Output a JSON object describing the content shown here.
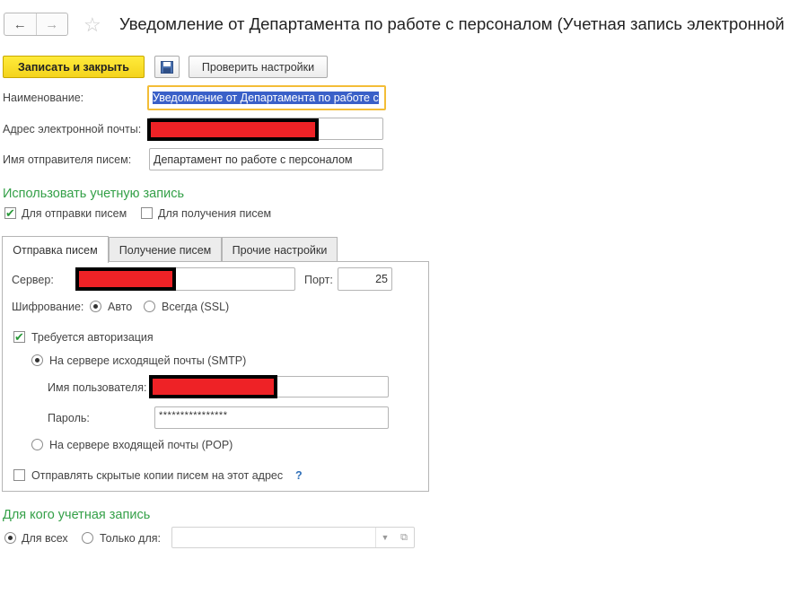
{
  "header": {
    "back_icon": "arrow-left-icon",
    "forward_icon": "arrow-right-icon",
    "favorite_icon": "star-icon",
    "title": "Уведомление от Департамента по работе с персоналом (Учетная запись электронной"
  },
  "toolbar": {
    "save_close_label": "Записать и закрыть",
    "save_icon": "floppy-disk-icon",
    "check_settings_label": "Проверить настройки"
  },
  "form": {
    "name_label": "Наименование:",
    "name_value": "Уведомление от Департамента по работе с",
    "email_label": "Адрес электронной почты:",
    "sender_label": "Имя отправителя писем:",
    "sender_value": "Департамент по работе с персоналом"
  },
  "use_account": {
    "heading": "Использовать учетную запись",
    "send_label": "Для отправки писем",
    "send_checked": true,
    "receive_label": "Для получения писем",
    "receive_checked": false
  },
  "tabs": [
    {
      "label": "Отправка писем",
      "active": true
    },
    {
      "label": "Получение писем",
      "active": false
    },
    {
      "label": "Прочие настройки",
      "active": false
    }
  ],
  "sending": {
    "server_label": "Сервер:",
    "port_label": "Порт:",
    "port_value": "25",
    "encryption_label": "Шифрование:",
    "enc_auto_label": "Авто",
    "enc_ssl_label": "Всегда (SSL)",
    "enc_selected": "Авто",
    "auth_label": "Требуется авторизация",
    "auth_checked": true,
    "smtp_label": "На сервере исходящей почты (SMTP)",
    "username_label": "Имя пользователя:",
    "password_label": "Пароль:",
    "password_value": "****************",
    "pop_label": "На сервере входящей почты (POP)",
    "bcc_label": "Отправлять скрытые копии писем на этот адрес",
    "bcc_help": "?"
  },
  "owner": {
    "heading": "Для кого учетная запись",
    "all_label": "Для всех",
    "only_label": "Только для:",
    "selected": "Для всех",
    "dropdown_icon": "dropdown-arrow-icon",
    "open_icon": "open-form-icon"
  }
}
